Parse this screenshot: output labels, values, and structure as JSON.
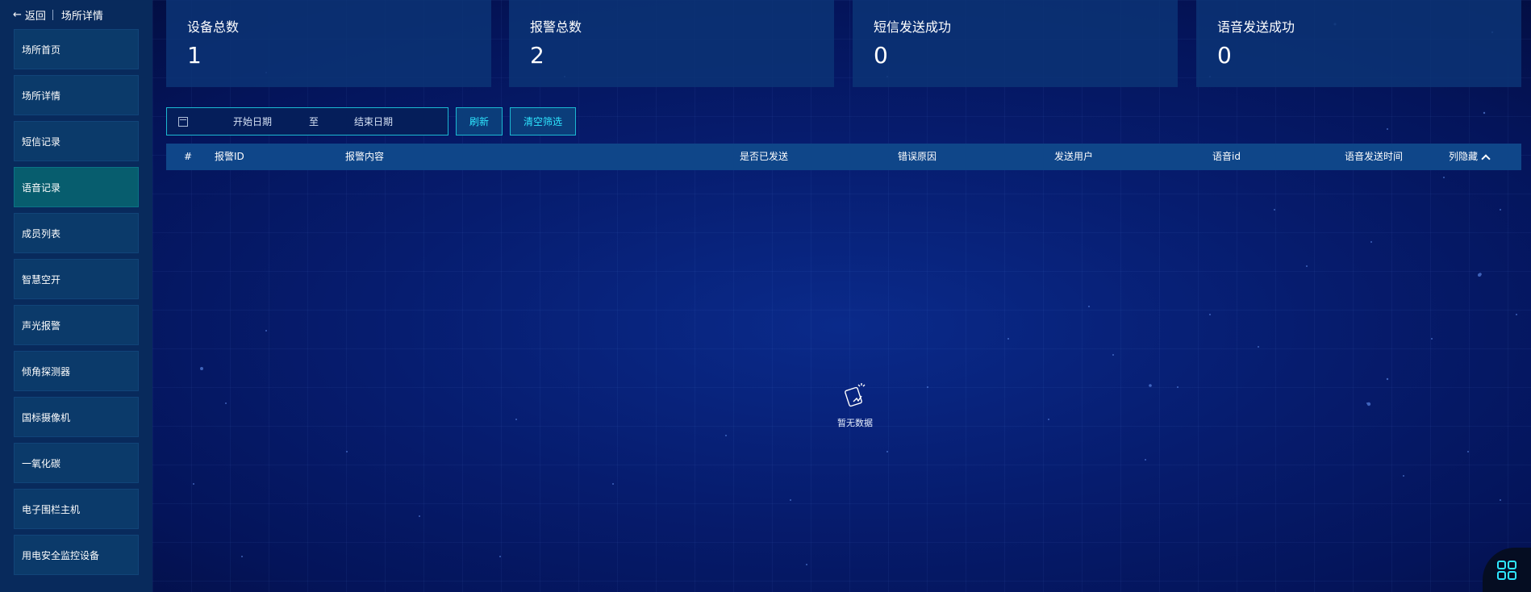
{
  "sidebar": {
    "back_label": "返回",
    "title": "场所详情",
    "items": [
      {
        "label": "场所首页"
      },
      {
        "label": "场所详情"
      },
      {
        "label": "短信记录"
      },
      {
        "label": "语音记录",
        "active": true
      },
      {
        "label": "成员列表"
      },
      {
        "label": "智慧空开"
      },
      {
        "label": "声光报警"
      },
      {
        "label": "倾角探测器"
      },
      {
        "label": "国标摄像机"
      },
      {
        "label": "一氧化碳"
      },
      {
        "label": "电子围栏主机"
      },
      {
        "label": "用电安全监控设备"
      }
    ]
  },
  "stats": [
    {
      "label": "设备总数",
      "value": "1"
    },
    {
      "label": "报警总数",
      "value": "2"
    },
    {
      "label": "短信发送成功",
      "value": "0"
    },
    {
      "label": "语音发送成功",
      "value": "0"
    }
  ],
  "filter": {
    "start_placeholder": "开始日期",
    "separator": "至",
    "end_placeholder": "结束日期",
    "refresh_label": "刷新",
    "clear_label": "清空筛选"
  },
  "table": {
    "columns": [
      "#",
      "报警ID",
      "报警内容",
      "是否已发送",
      "错误原因",
      "发送用户",
      "语音id",
      "语音发送时间"
    ],
    "column_toggle_label": "列隐藏",
    "rows": [],
    "empty_text": "暂无数据"
  },
  "colors": {
    "accent": "#2ee6ff",
    "sidebar_bg": "#082a5c",
    "active_item": "#075d6e",
    "card_bg": "#0c3476",
    "table_header": "#0f4689"
  },
  "icons": {
    "back": "arrow-left-icon",
    "calendar": "calendar-icon",
    "empty": "empty-data-icon",
    "toggle": "chevron-up-icon",
    "apps": "apps-grid-icon"
  }
}
